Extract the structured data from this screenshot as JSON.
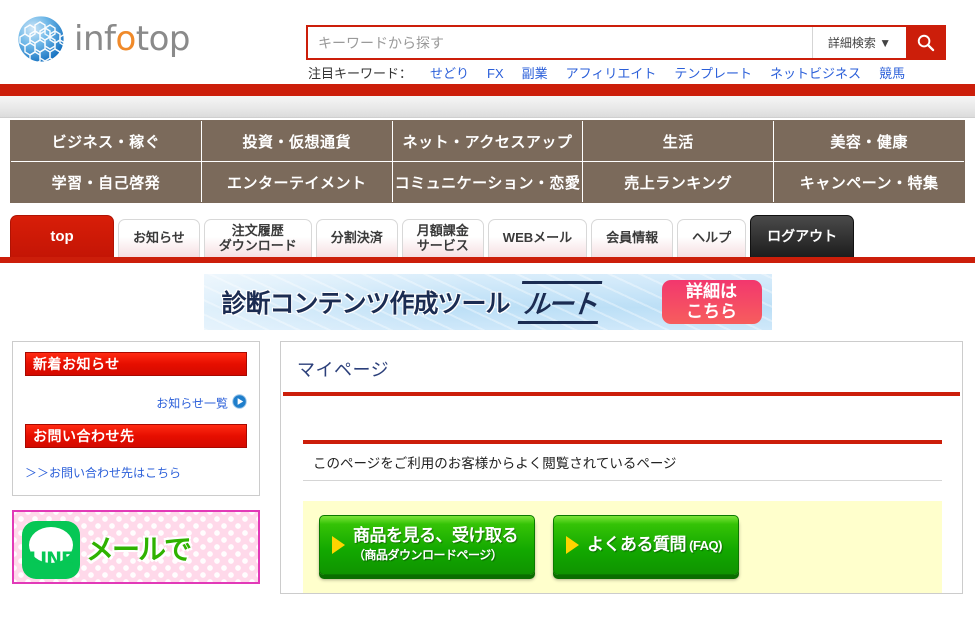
{
  "header": {
    "logo_text_parts": {
      "pre": "inf",
      "orange_o": "o",
      "post": "top"
    },
    "logo_alt": "infotop",
    "search": {
      "placeholder": "キーワードから探す",
      "value": "",
      "advanced_label": "詳細検索 ▼",
      "search_icon": "search-icon"
    },
    "keywords_label": "注目キーワード：",
    "keywords": [
      "せどり",
      "FX",
      "副業",
      "アフィリエイト",
      "テンプレート",
      "ネットビジネス",
      "競馬"
    ]
  },
  "category_nav": {
    "row1": [
      "ビジネス・稼ぐ",
      "投資・仮想通貨",
      "ネット・アクセスアップ",
      "生活",
      "美容・健康"
    ],
    "row2": [
      "学習・自己啓発",
      "エンターテイメント",
      "コミュニケーション・恋愛",
      "売上ランキング",
      "キャンペーン・特集"
    ]
  },
  "tabs": [
    {
      "label": "top",
      "state": "active"
    },
    {
      "label": "お知らせ",
      "state": "normal"
    },
    {
      "label": "注文履歴\nダウンロード",
      "state": "normal"
    },
    {
      "label": "分割決済",
      "state": "normal"
    },
    {
      "label": "月額課金\nサービス",
      "state": "normal"
    },
    {
      "label": "WEBメール",
      "state": "normal"
    },
    {
      "label": "会員情報",
      "state": "normal"
    },
    {
      "label": "ヘルプ",
      "state": "normal"
    },
    {
      "label": "ログアウト",
      "state": "logout"
    }
  ],
  "banner": {
    "title": "診断コンテンツ作成ツール",
    "product_logo": "ルート",
    "cta": "詳細は\nこちら"
  },
  "sidebar": {
    "news_header": "新着お知らせ",
    "news_list_link": "お知らせ一覧",
    "news_list_icon": "play-circle-icon",
    "contact_header": "お問い合わせ先",
    "contact_link": "＞＞お問い合わせ先はこちら",
    "line_banner": {
      "mark_label": "LINE",
      "copy": "メールで"
    }
  },
  "main": {
    "title": "マイページ",
    "section_header": "このページをご利用のお客様からよく閲覧されているページ",
    "buttons": [
      {
        "line1": "商品を見る、受け取る",
        "line2": "（商品ダウンロードページ）"
      },
      {
        "line1": "よくある質問",
        "line1_small": " (FAQ)",
        "line2": ""
      }
    ]
  },
  "colors": {
    "brand_red": "#CC1E0A",
    "nav_brown": "#7B6A5B",
    "link_blue": "#2B5FD9",
    "button_green": "#12A800",
    "panel_yellow": "#FFFFCC",
    "line_green": "#06C755",
    "logo_orange": "#F08A2A"
  }
}
